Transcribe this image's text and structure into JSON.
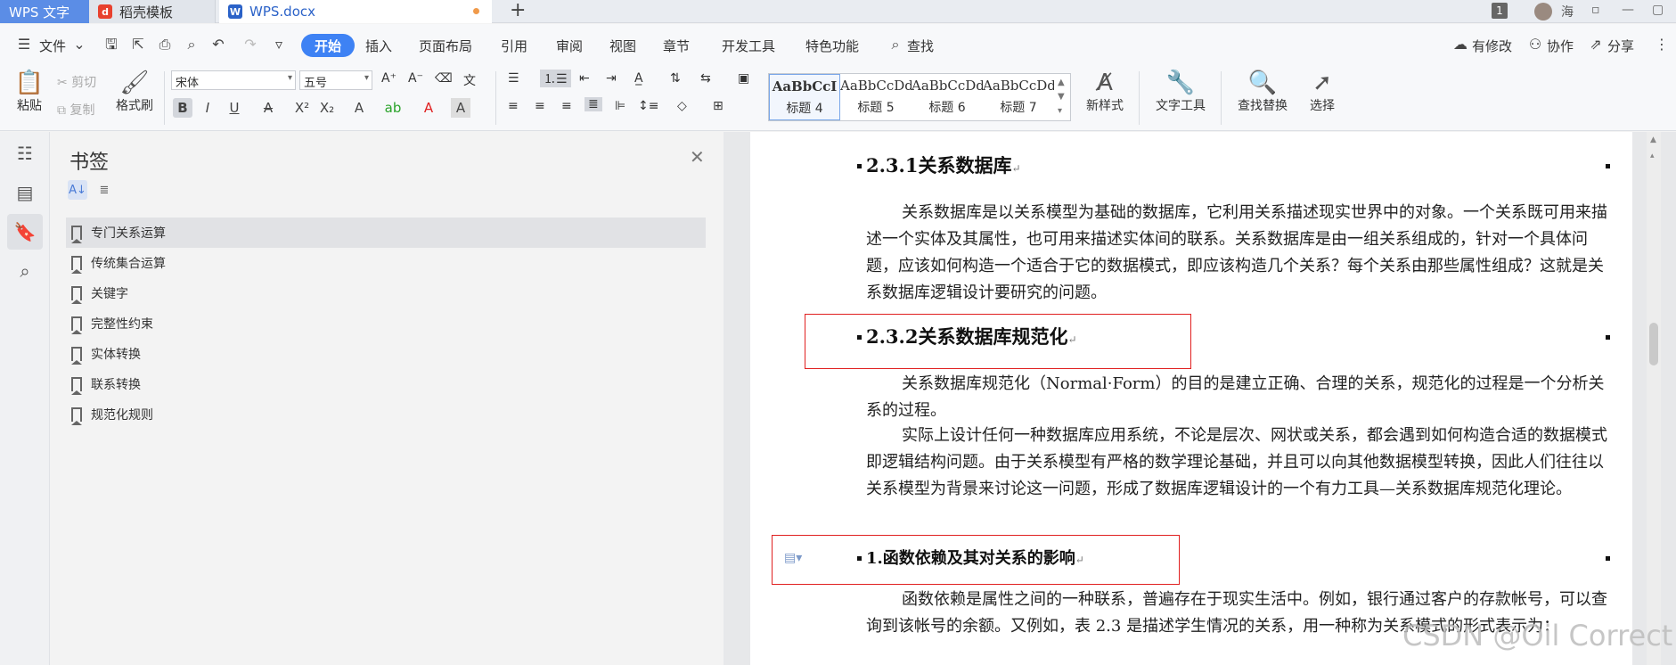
{
  "titlebar": {
    "app_tab": "WPS 文字",
    "template_tab": "稻壳模板",
    "file_tab": "WPS.docx",
    "badge": "1",
    "user_name": "海"
  },
  "menu": {
    "file": "文件",
    "start": "开始",
    "items": [
      "插入",
      "页面布局",
      "引用",
      "审阅",
      "视图",
      "章节",
      "开发工具",
      "特色功能"
    ],
    "search": "查找",
    "modified": "有修改",
    "collab": "协作",
    "share": "分享"
  },
  "ribbon": {
    "paste": "粘贴",
    "cut": "剪切",
    "copy": "复制",
    "format_painter": "格式刷",
    "font_name": "宋体",
    "font_size": "五号",
    "styles": [
      {
        "sample": "AaBbCcI",
        "name": "标题 4"
      },
      {
        "sample": "AaBbCcDd",
        "name": "标题 5"
      },
      {
        "sample": "AaBbCcDd",
        "name": "标题 6"
      },
      {
        "sample": "AaBbCcDd",
        "name": "标题 7"
      }
    ],
    "new_style": "新样式",
    "text_tools": "文字工具",
    "find_replace": "查找替换",
    "select": "选择"
  },
  "panel": {
    "title": "书签",
    "bookmarks": [
      "专门关系运算",
      "传统集合运算",
      "关键字",
      "完整性约束",
      "实体转换",
      "联系转换",
      "规范化规则"
    ]
  },
  "document": {
    "h231": "2.3.1关系数据库",
    "p1": "关系数据库是以关系模型为基础的数据库，它利用关系描述现实世界中的对象。一个关系既可用来描述一个实体及其属性，也可用来描述实体间的联系。关系数据库是由一组关系组成的，针对一个具体问题，应该如何构造一个适合于它的数据模式，即应该构造几个关系？每个关系由那些属性组成？这就是关系数据库逻辑设计要研究的问题。",
    "h232": "2.3.2关系数据库规范化",
    "p2": "关系数据库规范化（Normal·Form）的目的是建立正确、合理的关系，规范化的过程是一个分析关系的过程。",
    "p3": "实际上设计任何一种数据库应用系统，不论是层次、网状或关系，都会遇到如何构造合适的数据模式即逻辑结构问题。由于关系模型有严格的数学理论基础，并且可以向其他数据模型转换，因此人们往往以关系模型为背景来讨论这一问题，形成了数据库逻辑设计的一个有力工具—关系数据库规范化理论。",
    "h1": "1.函数依赖及其对关系的影响",
    "p4": "函数依赖是属性之间的一种联系，普遍存在于现实生活中。例如，银行通过客户的存款帐号，可以查询到该帐号的余额。又例如，表 2.3 是描述学生情况的关系，用一种称为关系模式的形式表示为："
  },
  "watermark": "CSDN @Oil Correct",
  "colors": {
    "accent": "#3e82f4",
    "highlight_box": "#e02020"
  }
}
